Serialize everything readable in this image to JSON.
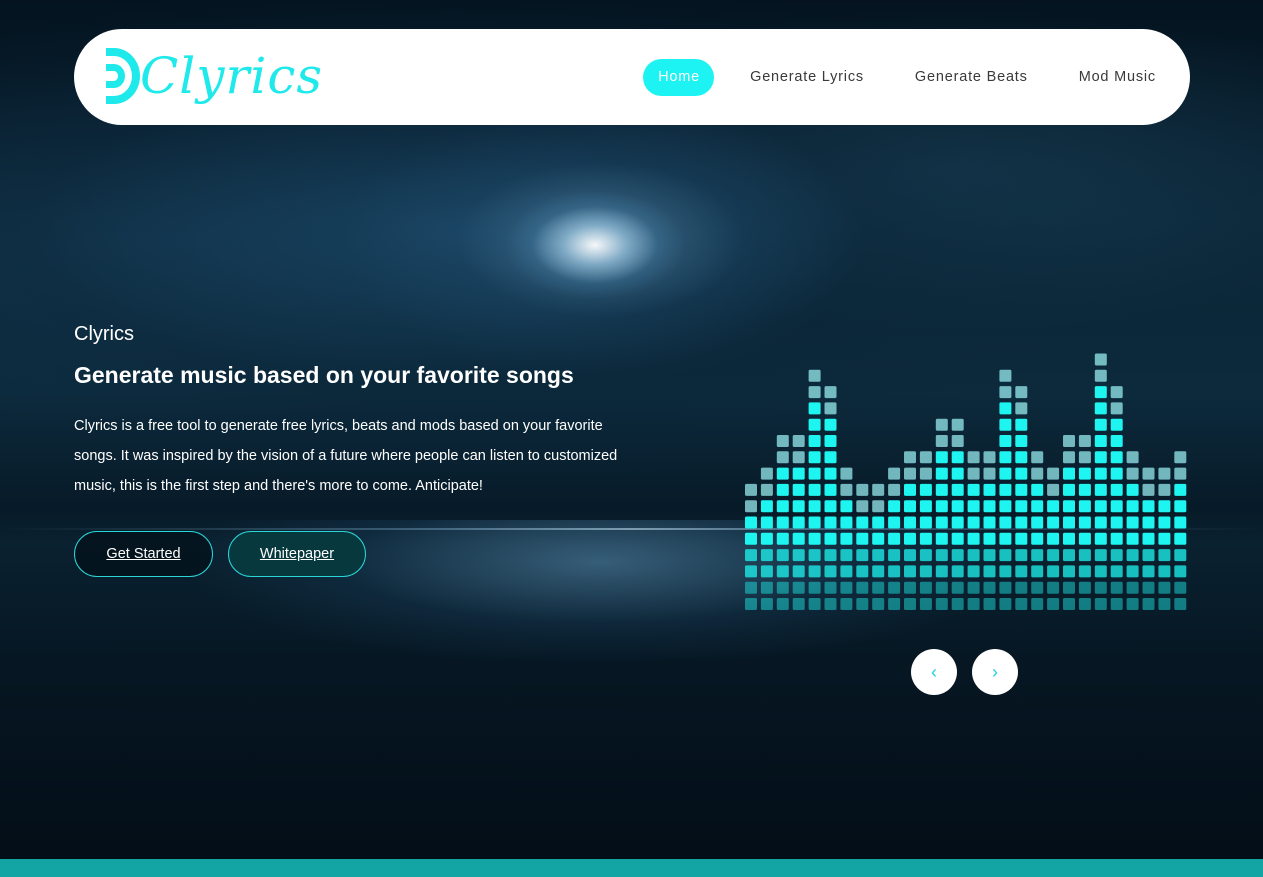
{
  "brand": {
    "name": "Clyrics",
    "accent": "#1fe9ea"
  },
  "nav": {
    "items": [
      {
        "label": "Home",
        "active": true
      },
      {
        "label": "Generate Lyrics",
        "active": false
      },
      {
        "label": "Generate Beats",
        "active": false
      },
      {
        "label": "Mod Music",
        "active": false
      }
    ]
  },
  "hero": {
    "eyebrow": "Clyrics",
    "title": "Generate music based on your favorite songs",
    "description": "Clyrics is a free tool to generate free lyrics, beats and mods based on your favorite songs. It was inspired by the vision of a future where people can listen to customized music, this is the first step and there's more to come. Anticipate!",
    "buttons": {
      "get_started": "Get Started",
      "whitepaper": "Whitepaper"
    }
  },
  "carousel": {
    "prev_icon": "chevron-left-icon",
    "next_icon": "chevron-right-icon",
    "prev_glyph": "‹",
    "next_glyph": "›"
  },
  "colors": {
    "footer_strip": "#12a5a3",
    "nav_active": "#1ef3f4",
    "equalizer": "#1ef5f0"
  },
  "equalizer_levels": [
    8,
    9,
    11,
    11,
    15,
    14,
    9,
    8,
    8,
    9,
    10,
    10,
    12,
    12,
    10,
    10,
    15,
    14,
    10,
    9,
    11,
    11,
    16,
    14,
    10,
    9,
    9,
    10
  ]
}
